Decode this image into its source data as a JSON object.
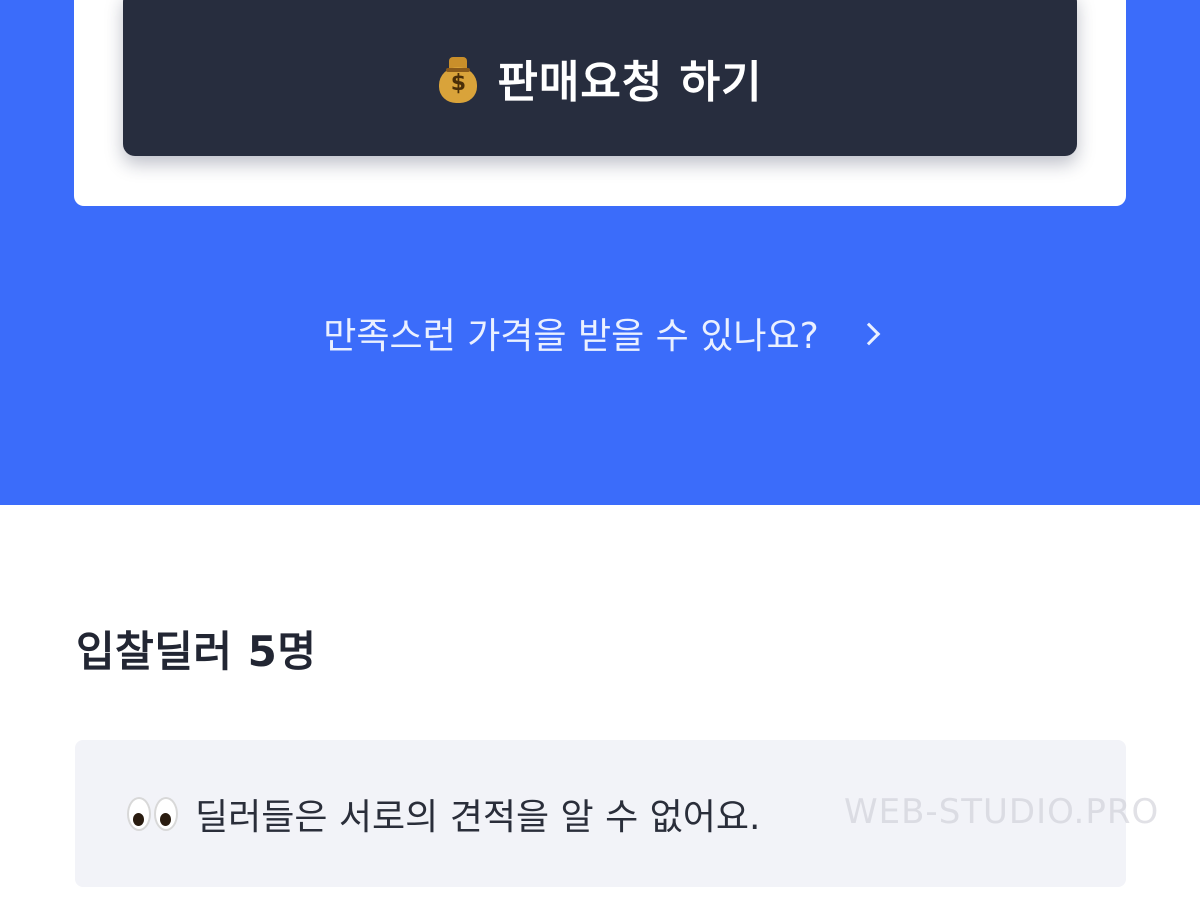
{
  "sell_request": {
    "icon": "money-bag-icon",
    "label": "판매요청 하기"
  },
  "price_question": {
    "text": "만족스런 가격을 받을 수 있나요?",
    "icon": "chevron-right-icon"
  },
  "dealers": {
    "heading": "입찰딜러 5명"
  },
  "notice": {
    "icon": "eyes-icon",
    "text": "딜러들은 서로의 견적을 알 수 없어요."
  },
  "watermark": "WEB-STUDIO.PRO",
  "colors": {
    "brand_blue": "#3b6cfa",
    "button_dark": "#272d3e",
    "notice_bg": "#f2f3f8"
  }
}
